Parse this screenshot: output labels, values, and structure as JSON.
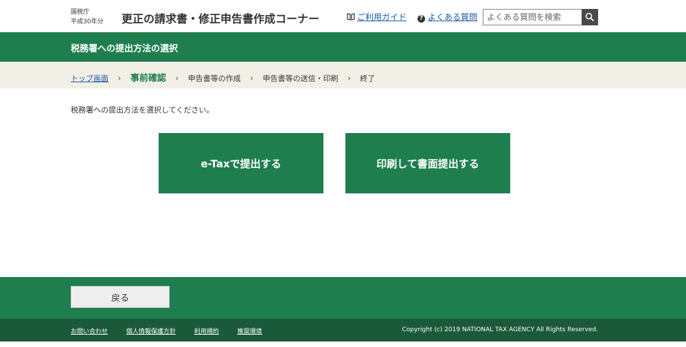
{
  "header": {
    "agency_name": "国税庁",
    "year_label": "平成30年分",
    "app_title": "更正の請求書・修正申告書作成コーナー",
    "guide_link": "ご利用ガイド",
    "faq_link": "よくある質問",
    "search_placeholder": "よくある質問を検索"
  },
  "page": {
    "heading": "税務署への提出方法の選択",
    "instruction": "税務署への提出方法を選択してください。"
  },
  "breadcrumb": {
    "items": [
      "トップ画面",
      "事前確認",
      "申告書等の作成",
      "申告書等の送信・印刷",
      "終了"
    ],
    "separator": "›"
  },
  "options": {
    "etax_label": "e-Taxで提出する",
    "print_label": "印刷して書面提出する"
  },
  "footer": {
    "back_label": "戻る",
    "links": [
      "お問い合わせ",
      "個人情報保護方針",
      "利用規約",
      "推奨環境"
    ],
    "copyright": "Copyright (c) 2019 NATIONAL TAX AGENCY All Rights Reserved."
  },
  "colors": {
    "brand_green": "#1e7e4e",
    "footer_dark_green": "#1a5a3a",
    "breadcrumb_bg": "#f2f0e6",
    "link_blue": "#1a5aa8"
  }
}
